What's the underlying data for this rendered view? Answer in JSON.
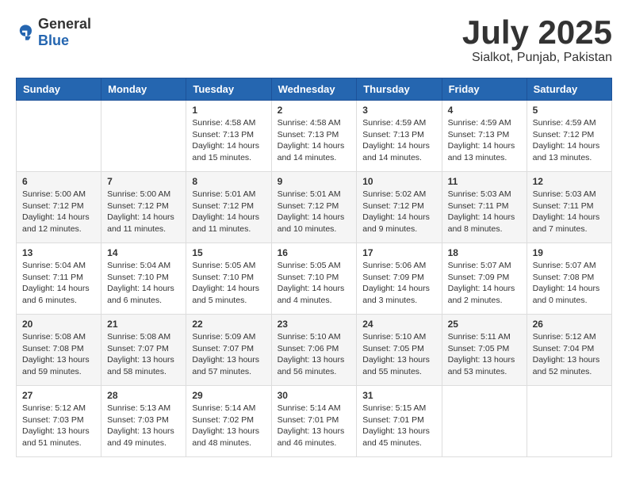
{
  "header": {
    "logo_general": "General",
    "logo_blue": "Blue",
    "month_title": "July 2025",
    "location": "Sialkot, Punjab, Pakistan"
  },
  "days_of_week": [
    "Sunday",
    "Monday",
    "Tuesday",
    "Wednesday",
    "Thursday",
    "Friday",
    "Saturday"
  ],
  "weeks": [
    [
      {
        "day": "",
        "content": ""
      },
      {
        "day": "",
        "content": ""
      },
      {
        "day": "1",
        "content": "Sunrise: 4:58 AM\nSunset: 7:13 PM\nDaylight: 14 hours and 15 minutes."
      },
      {
        "day": "2",
        "content": "Sunrise: 4:58 AM\nSunset: 7:13 PM\nDaylight: 14 hours and 14 minutes."
      },
      {
        "day": "3",
        "content": "Sunrise: 4:59 AM\nSunset: 7:13 PM\nDaylight: 14 hours and 14 minutes."
      },
      {
        "day": "4",
        "content": "Sunrise: 4:59 AM\nSunset: 7:13 PM\nDaylight: 14 hours and 13 minutes."
      },
      {
        "day": "5",
        "content": "Sunrise: 4:59 AM\nSunset: 7:12 PM\nDaylight: 14 hours and 13 minutes."
      }
    ],
    [
      {
        "day": "6",
        "content": "Sunrise: 5:00 AM\nSunset: 7:12 PM\nDaylight: 14 hours and 12 minutes."
      },
      {
        "day": "7",
        "content": "Sunrise: 5:00 AM\nSunset: 7:12 PM\nDaylight: 14 hours and 11 minutes."
      },
      {
        "day": "8",
        "content": "Sunrise: 5:01 AM\nSunset: 7:12 PM\nDaylight: 14 hours and 11 minutes."
      },
      {
        "day": "9",
        "content": "Sunrise: 5:01 AM\nSunset: 7:12 PM\nDaylight: 14 hours and 10 minutes."
      },
      {
        "day": "10",
        "content": "Sunrise: 5:02 AM\nSunset: 7:12 PM\nDaylight: 14 hours and 9 minutes."
      },
      {
        "day": "11",
        "content": "Sunrise: 5:03 AM\nSunset: 7:11 PM\nDaylight: 14 hours and 8 minutes."
      },
      {
        "day": "12",
        "content": "Sunrise: 5:03 AM\nSunset: 7:11 PM\nDaylight: 14 hours and 7 minutes."
      }
    ],
    [
      {
        "day": "13",
        "content": "Sunrise: 5:04 AM\nSunset: 7:11 PM\nDaylight: 14 hours and 6 minutes."
      },
      {
        "day": "14",
        "content": "Sunrise: 5:04 AM\nSunset: 7:10 PM\nDaylight: 14 hours and 6 minutes."
      },
      {
        "day": "15",
        "content": "Sunrise: 5:05 AM\nSunset: 7:10 PM\nDaylight: 14 hours and 5 minutes."
      },
      {
        "day": "16",
        "content": "Sunrise: 5:05 AM\nSunset: 7:10 PM\nDaylight: 14 hours and 4 minutes."
      },
      {
        "day": "17",
        "content": "Sunrise: 5:06 AM\nSunset: 7:09 PM\nDaylight: 14 hours and 3 minutes."
      },
      {
        "day": "18",
        "content": "Sunrise: 5:07 AM\nSunset: 7:09 PM\nDaylight: 14 hours and 2 minutes."
      },
      {
        "day": "19",
        "content": "Sunrise: 5:07 AM\nSunset: 7:08 PM\nDaylight: 14 hours and 0 minutes."
      }
    ],
    [
      {
        "day": "20",
        "content": "Sunrise: 5:08 AM\nSunset: 7:08 PM\nDaylight: 13 hours and 59 minutes."
      },
      {
        "day": "21",
        "content": "Sunrise: 5:08 AM\nSunset: 7:07 PM\nDaylight: 13 hours and 58 minutes."
      },
      {
        "day": "22",
        "content": "Sunrise: 5:09 AM\nSunset: 7:07 PM\nDaylight: 13 hours and 57 minutes."
      },
      {
        "day": "23",
        "content": "Sunrise: 5:10 AM\nSunset: 7:06 PM\nDaylight: 13 hours and 56 minutes."
      },
      {
        "day": "24",
        "content": "Sunrise: 5:10 AM\nSunset: 7:05 PM\nDaylight: 13 hours and 55 minutes."
      },
      {
        "day": "25",
        "content": "Sunrise: 5:11 AM\nSunset: 7:05 PM\nDaylight: 13 hours and 53 minutes."
      },
      {
        "day": "26",
        "content": "Sunrise: 5:12 AM\nSunset: 7:04 PM\nDaylight: 13 hours and 52 minutes."
      }
    ],
    [
      {
        "day": "27",
        "content": "Sunrise: 5:12 AM\nSunset: 7:03 PM\nDaylight: 13 hours and 51 minutes."
      },
      {
        "day": "28",
        "content": "Sunrise: 5:13 AM\nSunset: 7:03 PM\nDaylight: 13 hours and 49 minutes."
      },
      {
        "day": "29",
        "content": "Sunrise: 5:14 AM\nSunset: 7:02 PM\nDaylight: 13 hours and 48 minutes."
      },
      {
        "day": "30",
        "content": "Sunrise: 5:14 AM\nSunset: 7:01 PM\nDaylight: 13 hours and 46 minutes."
      },
      {
        "day": "31",
        "content": "Sunrise: 5:15 AM\nSunset: 7:01 PM\nDaylight: 13 hours and 45 minutes."
      },
      {
        "day": "",
        "content": ""
      },
      {
        "day": "",
        "content": ""
      }
    ]
  ]
}
